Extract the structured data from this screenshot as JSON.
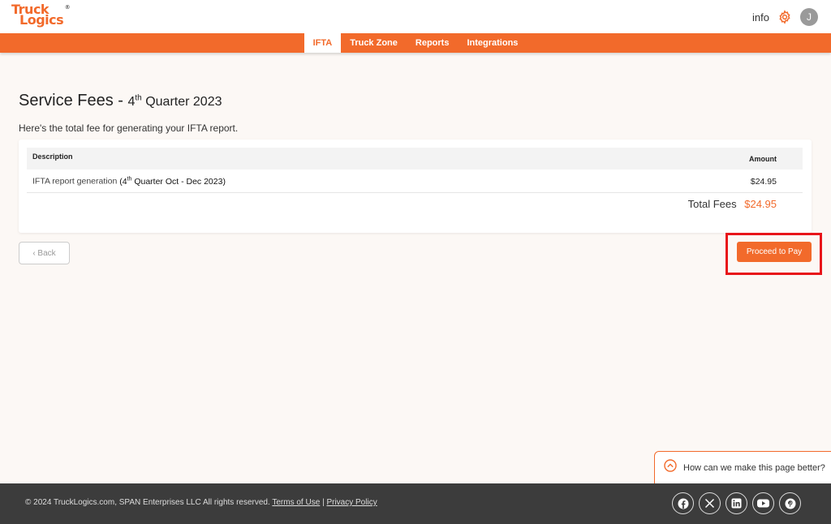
{
  "brand": {
    "line1": "Truck",
    "line2": "Logics",
    "mark": "®"
  },
  "header": {
    "info_label": "info",
    "avatar_initial": "J"
  },
  "nav": {
    "items": [
      "IFTA",
      "Truck Zone",
      "Reports",
      "Integrations"
    ],
    "active": "IFTA"
  },
  "page": {
    "title_main": "Service Fees -",
    "title_q_num": "4",
    "title_q_sup": "th",
    "title_q_rest": "Quarter 2023",
    "subtitle": "Here's the total fee for generating your IFTA report."
  },
  "table": {
    "col_description": "Description",
    "col_amount": "Amount",
    "row": {
      "desc_prefix": "IFTA report generation",
      "desc_open": "(4",
      "desc_sup": "th",
      "desc_rest": "Quarter Oct - Dec 2023)",
      "amount": "$24.95"
    },
    "total_label": "Total Fees",
    "total_value": "$24.95"
  },
  "actions": {
    "back": "‹ Back",
    "pay": "Proceed to Pay"
  },
  "feedback": {
    "text": "How can we make this page better?"
  },
  "footer": {
    "copyright": "© 2024 TruckLogics.com, SPAN Enterprises LLC All rights reserved.",
    "terms": "Terms of Use",
    "separator": "|",
    "privacy": "Privacy Policy",
    "socials": [
      "facebook",
      "x",
      "linkedin",
      "youtube",
      "pinterest"
    ]
  },
  "colors": {
    "accent": "#f26a2b",
    "highlight": "#e8141a",
    "footer_bg": "#3c3c3c"
  }
}
